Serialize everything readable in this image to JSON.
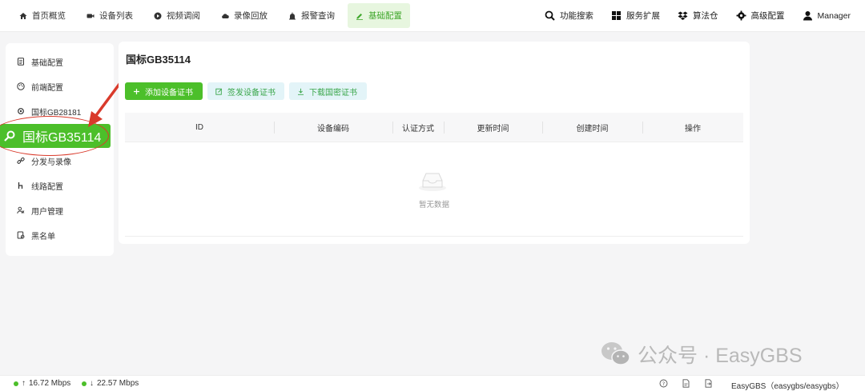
{
  "topnav": {
    "left": [
      {
        "icon": "home-icon",
        "label": "首页概览"
      },
      {
        "icon": "video-camera-icon",
        "label": "设备列表"
      },
      {
        "icon": "play-circle-icon",
        "label": "视频调阅"
      },
      {
        "icon": "cloud-icon",
        "label": "录像回放"
      },
      {
        "icon": "alarm-icon",
        "label": "报警查询"
      },
      {
        "icon": "edit-icon",
        "label": "基础配置",
        "active": true
      }
    ],
    "right": [
      {
        "icon": "search-icon",
        "label": "功能搜索"
      },
      {
        "icon": "grid-icon",
        "label": "服务扩展"
      },
      {
        "icon": "dropbox-icon",
        "label": "算法仓"
      },
      {
        "icon": "gear-icon",
        "label": "高级配置"
      },
      {
        "icon": "user-icon",
        "label": "Manager"
      }
    ]
  },
  "sidebar": {
    "items": [
      {
        "icon": "document-icon",
        "label": "基础配置"
      },
      {
        "icon": "palette-icon",
        "label": "前端配置"
      },
      {
        "icon": "gear-icon",
        "label": "国标GB28181"
      },
      {
        "icon": "search-icon",
        "label": "国标GB35114",
        "active": true
      },
      {
        "icon": "link-icon",
        "label": "分发与录像"
      },
      {
        "icon": "route-icon",
        "label": "线路配置"
      },
      {
        "icon": "users-icon",
        "label": "用户管理"
      },
      {
        "icon": "blacklist-icon",
        "label": "黑名单"
      }
    ]
  },
  "main": {
    "title": "国标GB35114",
    "buttons": {
      "add": "添加设备证书",
      "sign": "签发设备证书",
      "download": "下载国密证书"
    },
    "table": {
      "columns": [
        "ID",
        "设备编码",
        "认证方式",
        "更新时间",
        "创建时间",
        "操作"
      ],
      "rows": [],
      "empty_text": "暂无数据"
    }
  },
  "statusbar": {
    "upload": "16.72 Mbps",
    "download": "22.57 Mbps",
    "product": "EasyGBS（easygbs/easygbs）"
  },
  "watermark": {
    "text": "公众号 · EasyGBS"
  },
  "colors": {
    "accent": "#4cbf2a",
    "accent_light": "#e7f6df",
    "annotation_red": "#d93a2b"
  }
}
